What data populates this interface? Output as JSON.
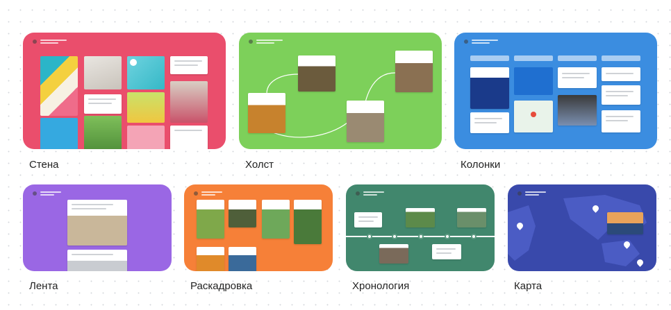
{
  "templates": [
    {
      "id": "wall",
      "label": "Стена",
      "color": "#ea4e6c"
    },
    {
      "id": "canvas",
      "label": "Холст",
      "color": "#7dd05a"
    },
    {
      "id": "columns",
      "label": "Колонки",
      "color": "#3b8de0"
    },
    {
      "id": "stream",
      "label": "Лента",
      "color": "#9a67e4"
    },
    {
      "id": "storyboard",
      "label": "Раскадровка",
      "color": "#f68038"
    },
    {
      "id": "timeline",
      "label": "Хронология",
      "color": "#41876d"
    },
    {
      "id": "map",
      "label": "Карта",
      "color": "#3949ab"
    }
  ]
}
